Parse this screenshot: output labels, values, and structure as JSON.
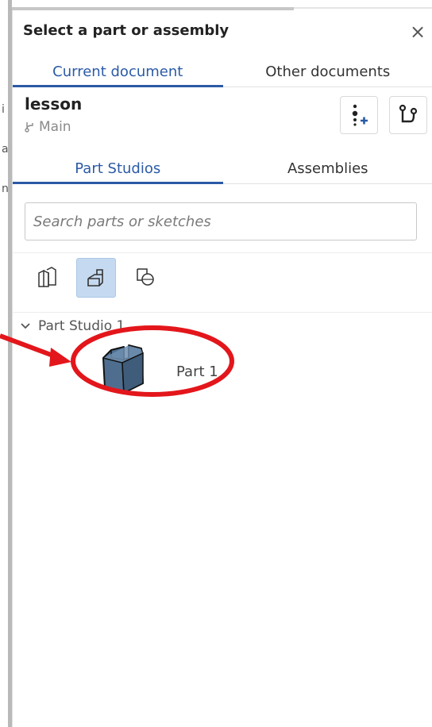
{
  "background": {
    "chars": [
      "i",
      "a",
      "n"
    ]
  },
  "dialog": {
    "title": "Select a part or assembly",
    "close_glyph": "×"
  },
  "tabs": {
    "current": "Current document",
    "other": "Other documents"
  },
  "document": {
    "name": "lesson",
    "branch": "Main"
  },
  "subtabs": {
    "part_studios": "Part Studios",
    "assemblies": "Assemblies"
  },
  "search": {
    "placeholder": "Search parts or sketches"
  },
  "tree": {
    "group": "Part Studio 1",
    "part": "Part 1"
  },
  "colors": {
    "accent": "#2b5aa6",
    "annotation": "#e3161b",
    "part_fill": "#4f6e8f"
  },
  "icons": {
    "close": "close-icon",
    "branch": "branch-icon",
    "add_version": "add-version-icon",
    "branch_graph": "version-graph-icon",
    "filter_parts": "parts-filter-icon",
    "filter_sketches": "sketch-filter-icon",
    "filter_surfaces": "surface-filter-icon",
    "expand": "chevron-down-icon",
    "part": "part-thumbnail-icon"
  }
}
